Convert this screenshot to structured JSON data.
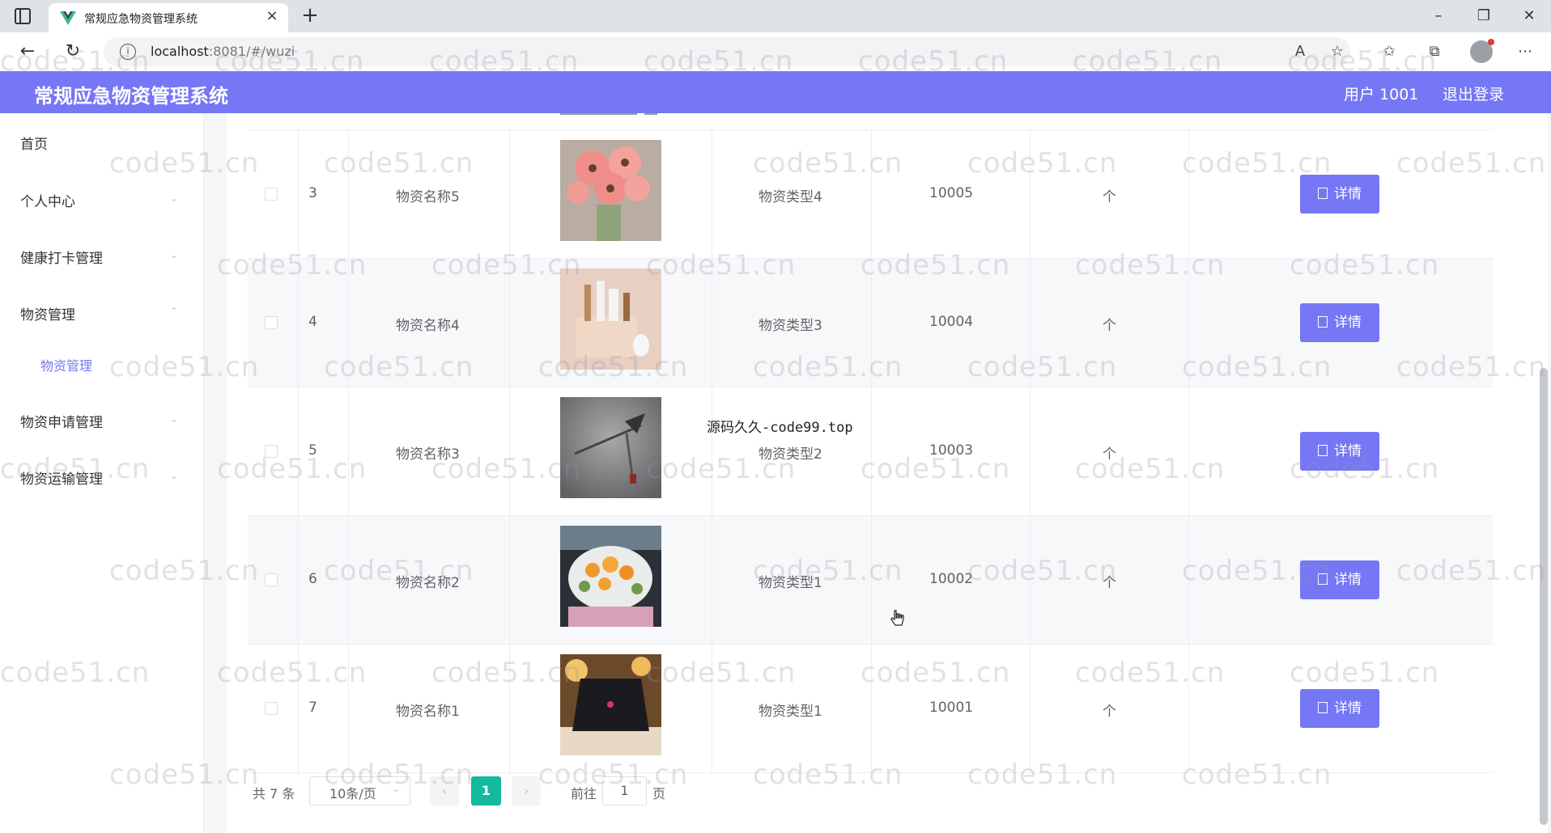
{
  "browser": {
    "tab_title": "常规应急物资管理系统",
    "url_host": "localhost",
    "url_rest": ":8081/#/wuzi"
  },
  "header": {
    "title": "常规应急物资管理系统",
    "user": "用户 1001",
    "logout": "退出登录"
  },
  "sidebar": {
    "items": [
      {
        "label": "首页"
      },
      {
        "label": "个人中心"
      },
      {
        "label": "健康打卡管理"
      },
      {
        "label": "物资管理"
      },
      {
        "label": "物资管理"
      },
      {
        "label": "物资申请管理"
      },
      {
        "label": "物资运输管理"
      }
    ]
  },
  "table": {
    "detail_label": "详情",
    "rows": [
      {
        "index": "3",
        "name": "物资名称5",
        "type": "物资类型4",
        "code": "10005",
        "unit": "个"
      },
      {
        "index": "4",
        "name": "物资名称4",
        "type": "物资类型3",
        "code": "10004",
        "unit": "个"
      },
      {
        "index": "5",
        "name": "物资名称3",
        "type": "物资类型2",
        "code": "10003",
        "unit": "个"
      },
      {
        "index": "6",
        "name": "物资名称2",
        "type": "物资类型1",
        "code": "10002",
        "unit": "个"
      },
      {
        "index": "7",
        "name": "物资名称1",
        "type": "物资类型1",
        "code": "10001",
        "unit": "个"
      }
    ]
  },
  "overlay_text": "源码久久-code99.top",
  "pagination": {
    "total": "共 7 条",
    "page_size": "10条/页",
    "current_page": "1",
    "goto_label": "前往",
    "goto_value": "1",
    "page_suffix": "页"
  },
  "watermark": "code51.cn",
  "colors": {
    "accent": "#7577f5",
    "pager_active": "#13ba9b"
  }
}
